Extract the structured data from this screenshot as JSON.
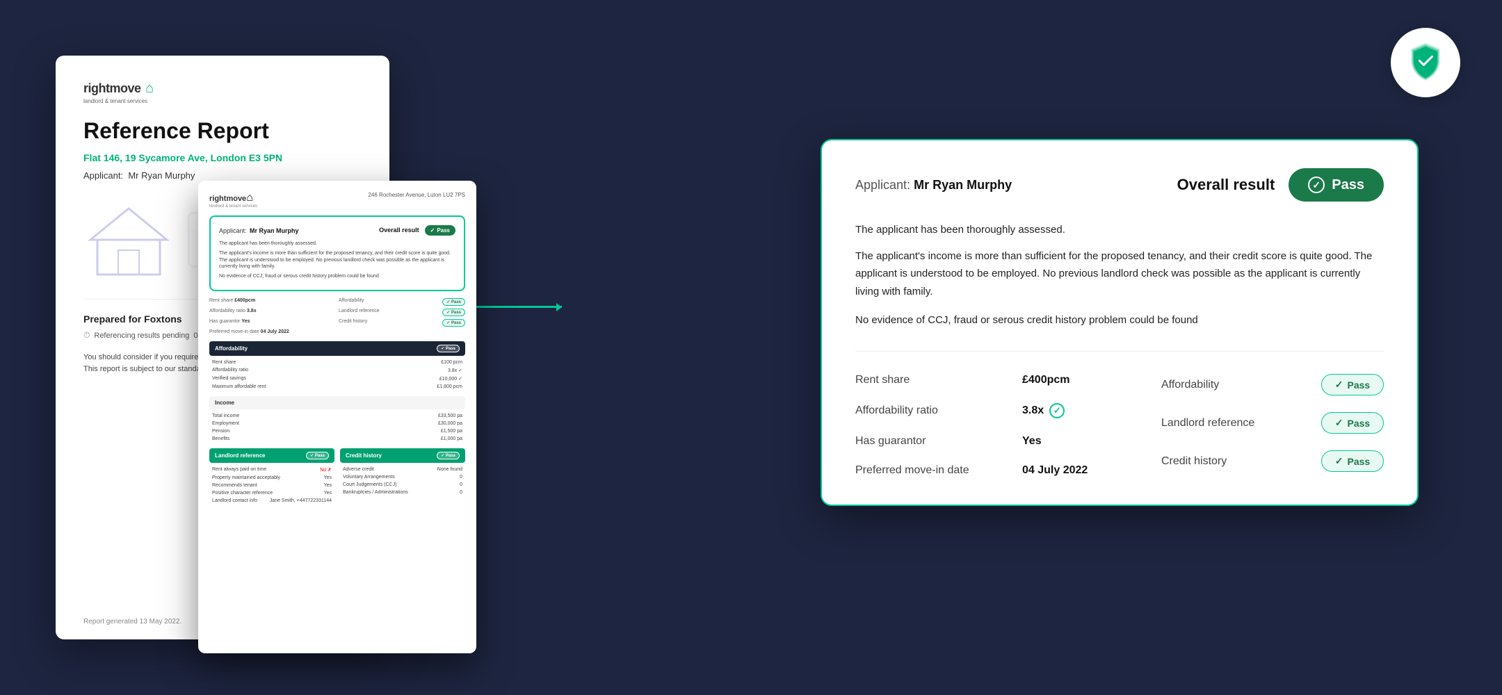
{
  "background_color": "#1e2540",
  "shield": {
    "aria_label": "security shield with checkmark"
  },
  "left_doc": {
    "logo_text": "rightmove",
    "logo_sub": "landlord & tenant services",
    "logo_house": "⌂",
    "title": "Reference Report",
    "address": "Flat 146, 19 Sycamore Ave, London E3 5PN",
    "applicant_label": "Applicant:",
    "applicant_name": "Mr Ryan Murphy",
    "prepared_for_label": "Prepared for Foxtons",
    "status_label": "Referencing results pending",
    "status_date": "02 March 2022",
    "body_text_1": "You should consider if you require Rent Guarantee & Legal Protection insurance. This report is subject to our standard Terms and Conditions.",
    "footer": "Report generated 13 May 2022."
  },
  "mid_doc": {
    "logo": "rightmove",
    "logo_sub": "landlord & tenant services",
    "address": "246 Rochester Avenue, Luton LU2 7PS",
    "applicant_label": "Applicant:",
    "applicant_name": "Mr Ryan Murphy",
    "result_label": "Overall result",
    "pass_label": "Pass",
    "text1": "The applicant has been thoroughly assessed.",
    "text2": "The applicant's income is more than sufficient for the proposed tenancy, and their credit score is quite good. The applicant is understood to be employed. No previous landlord check was possible as the applicant is currently living with family.",
    "text3": "No evidence of CCJ, fraud or serous credit history problem could be found",
    "rent_share_label": "Rent share",
    "rent_share_value": "£400pcm",
    "affordability_ratio_label": "Affordability ratio",
    "affordability_ratio_value": "3.8x",
    "has_guarantor_label": "Has guarantor",
    "has_guarantor_value": "Yes",
    "move_in_label": "Preferred move-in date",
    "move_in_value": "04 July 2022",
    "affordability_section": "Affordability",
    "affordability_pass": "Pass",
    "landlord_section": "Landlord reference",
    "landlord_pass": "Pass",
    "credit_section": "Credit history",
    "credit_pass": "Pass",
    "affordability_rows": [
      {
        "label": "Rent share",
        "value": "£100 pcm"
      },
      {
        "label": "Affordability ratio",
        "value": "3.8x"
      },
      {
        "label": "Verified savings",
        "value": "£10,000"
      },
      {
        "label": "Maximum affordable rent",
        "value": "£1,600 pcm"
      }
    ],
    "income_rows": [
      {
        "label": "Total income",
        "value": "£33,500 pa"
      },
      {
        "label": "Employment",
        "value": "£30,000 pa"
      },
      {
        "label": "Pension",
        "value": "£1,500 pa"
      },
      {
        "label": "Benefits",
        "value": "£1,000 pa"
      }
    ],
    "landlord_rows": [
      {
        "label": "Rent always paid on time",
        "value": "No"
      },
      {
        "label": "Property maintained acceptably",
        "value": "Yes"
      },
      {
        "label": "Recommends tenant",
        "value": "Yes"
      },
      {
        "label": "Positive character reference",
        "value": "Yes"
      },
      {
        "label": "Landlord contact info",
        "value": "Jane Smith, +447722331144"
      }
    ],
    "credit_rows": [
      {
        "label": "Adverse credit",
        "value": "None found"
      },
      {
        "label": "Voluntary Arrangements",
        "value": "0"
      },
      {
        "label": "Court Judgements (CCJ)",
        "value": "0"
      },
      {
        "label": "Bankruptcies / Administrations",
        "value": "0"
      }
    ]
  },
  "main_card": {
    "applicant_prefix": "Applicant:",
    "applicant_name": "Mr Ryan Murphy",
    "result_label": "Overall result",
    "pass_label": "Pass",
    "description_1": "The applicant has been thoroughly assessed.",
    "description_2": "The applicant's income is more than  sufficient for the proposed tenancy, and their credit score is quite good. The applicant is understood to be employed. No previous landlord check was possible as the applicant is currently living with family.",
    "no_evidence": "No evidence of CCJ, fraud or serous credit history problem could be found",
    "rent_share_label": "Rent share",
    "rent_share_value": "£400pcm",
    "affordability_ratio_label": "Affordability ratio",
    "affordability_ratio_value": "3.8x",
    "has_guarantor_label": "Has guarantor",
    "has_guarantor_value": "Yes",
    "move_in_label": "Preferred move-in date",
    "move_in_value": "04 July 2022",
    "right_items": [
      {
        "label": "Affordability",
        "status": "Pass"
      },
      {
        "label": "Landlord reference",
        "status": "Pass"
      },
      {
        "label": "Credit history",
        "status": "Pass"
      }
    ]
  }
}
